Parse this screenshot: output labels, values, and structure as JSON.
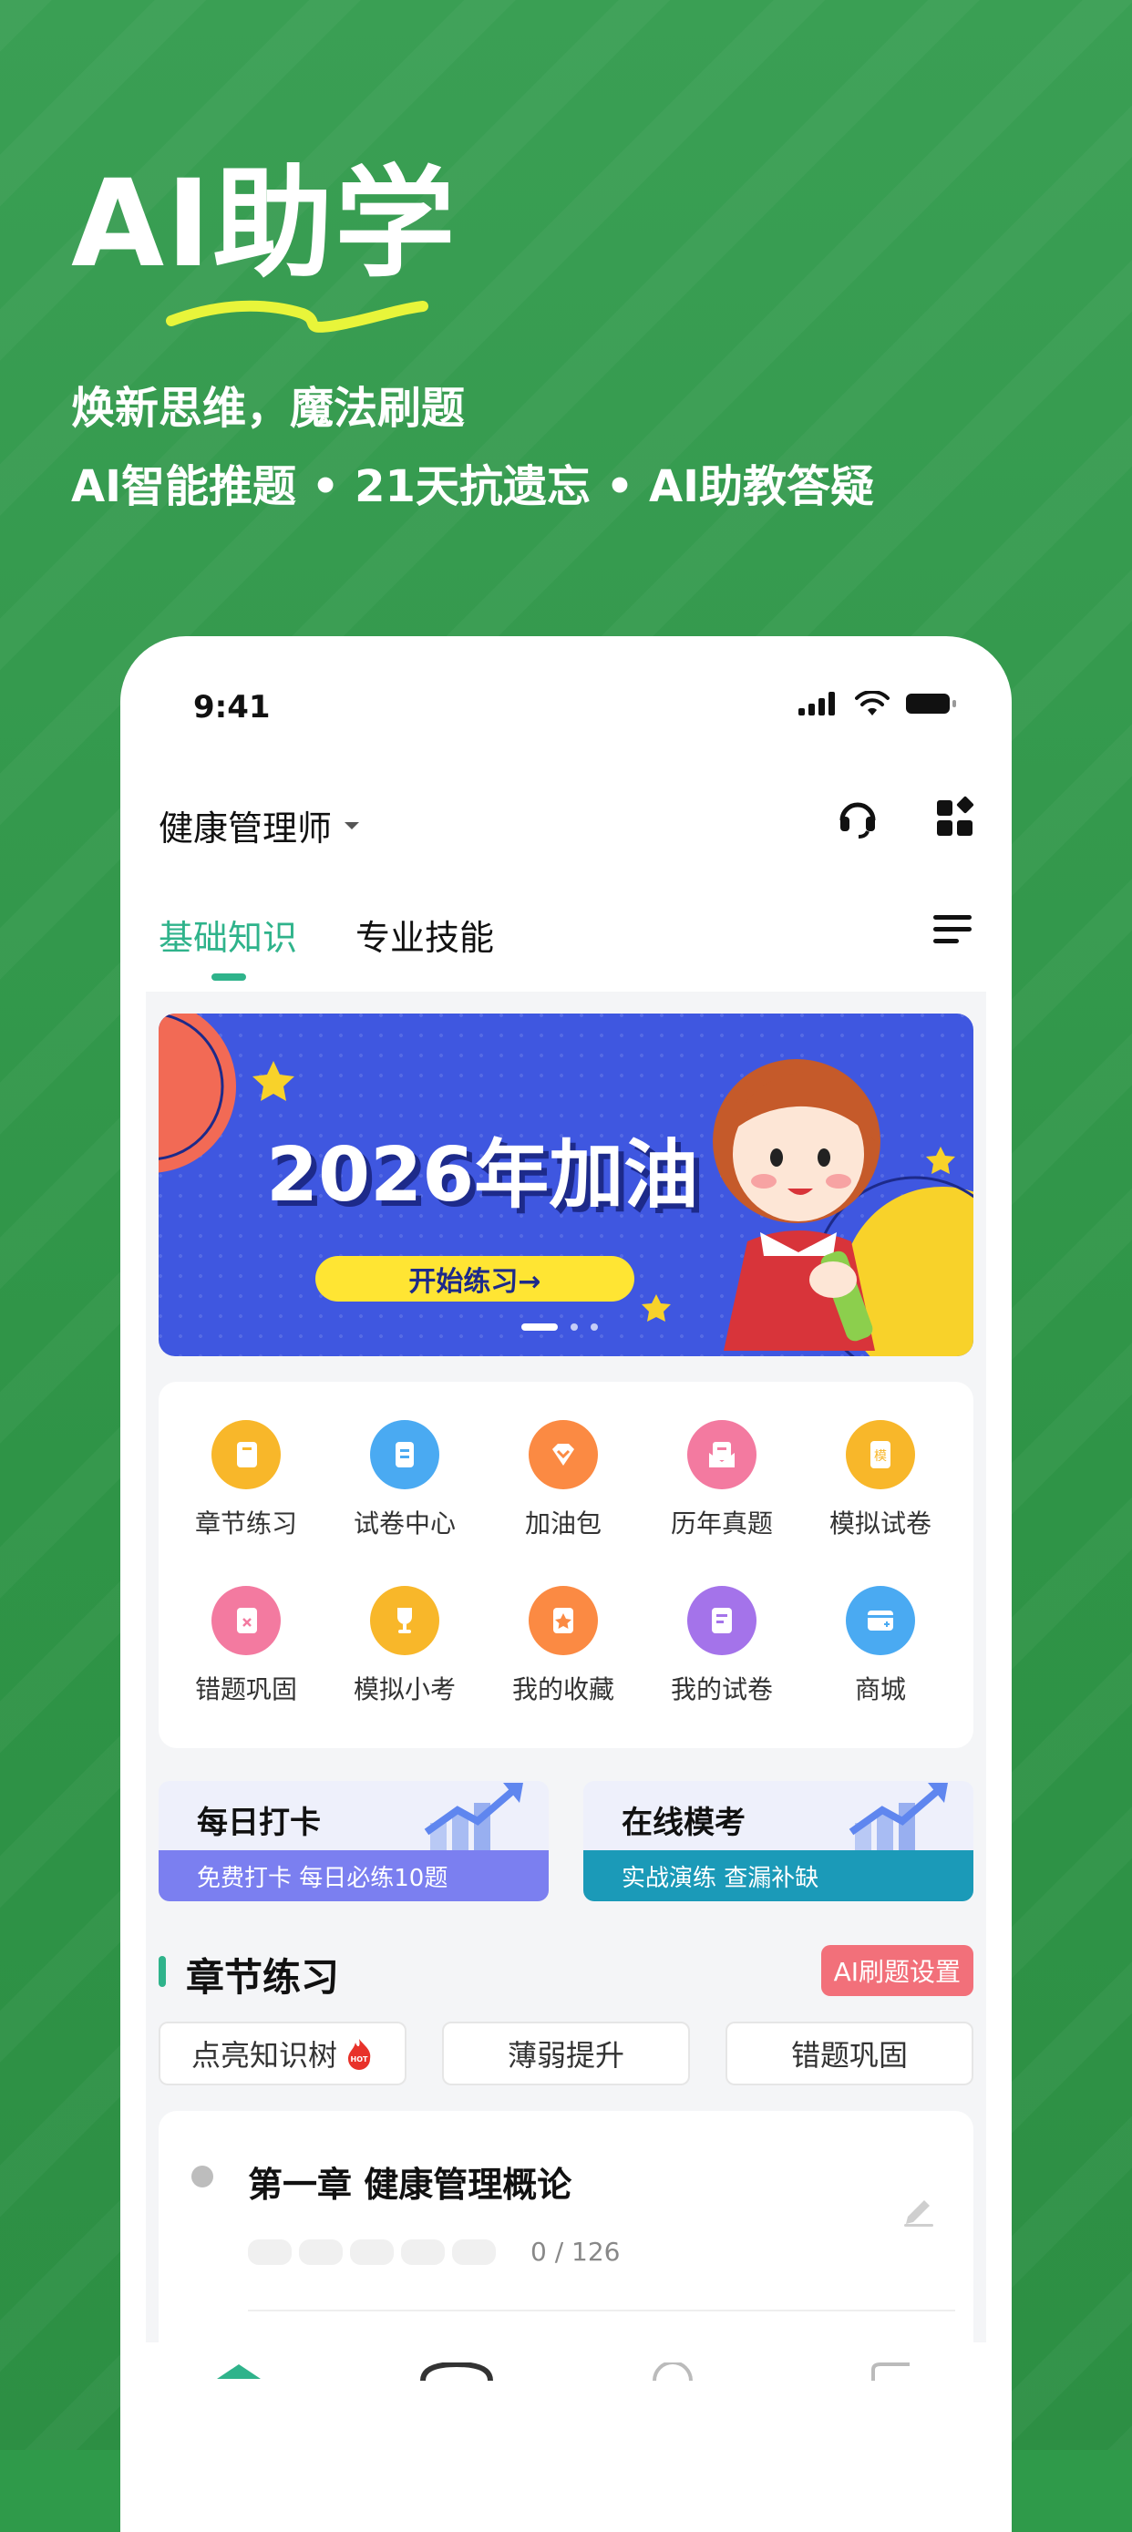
{
  "promo": {
    "title": "AI助学",
    "subtitle1": "焕新思维，魔法刷题",
    "subtitle2": "AI智能推题 • 21天抗遗忘 • AI助教答疑"
  },
  "status_bar": {
    "time": "9:41"
  },
  "header": {
    "exam": "健康管理师",
    "support_icon": "headset-icon",
    "apps_icon": "apps-icon"
  },
  "tabs": [
    {
      "label": "基础知识",
      "active": true
    },
    {
      "label": "专业技能",
      "active": false
    }
  ],
  "banner": {
    "title": "2026年加油",
    "button": "开始练习→"
  },
  "grid": [
    {
      "label": "章节练习",
      "color": "#f8b72a"
    },
    {
      "label": "试卷中心",
      "color": "#4aaaf2"
    },
    {
      "label": "加油包",
      "color": "#fb8a43"
    },
    {
      "label": "历年真题",
      "color": "#f37aa0"
    },
    {
      "label": "模拟试卷",
      "color": "#f8b72a",
      "glyph": "模"
    },
    {
      "label": "错题巩固",
      "color": "#f37aa0"
    },
    {
      "label": "模拟小考",
      "color": "#f8b72a"
    },
    {
      "label": "我的收藏",
      "color": "#fb8a43"
    },
    {
      "label": "我的试卷",
      "color": "#a473ea"
    },
    {
      "label": "商城",
      "color": "#4aaaf2"
    }
  ],
  "cards": [
    {
      "title": "每日打卡",
      "desc": "免费打卡 每日必练10题",
      "color": "#7b7ff0"
    },
    {
      "title": "在线模考",
      "desc": "实战演练  查漏补缺",
      "color": "#1b9ab8"
    }
  ],
  "section": {
    "title": "章节练习",
    "ai_setting": "AI刷题设置"
  },
  "filters": [
    {
      "label": "点亮知识树",
      "hot": "HOT"
    },
    {
      "label": "薄弱提升"
    },
    {
      "label": "错题巩固"
    }
  ],
  "chapter": {
    "title": "第一章  健康管理概论",
    "count": "0 / 126"
  },
  "colors": {
    "accent": "#2fb38b",
    "background": "#2f9a4a"
  }
}
